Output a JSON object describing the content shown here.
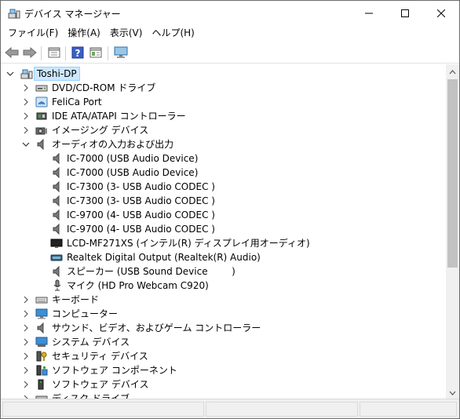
{
  "window": {
    "title": "デバイス マネージャー"
  },
  "menu": [
    {
      "label": "ファイル(F)"
    },
    {
      "label": "操作(A)"
    },
    {
      "label": "表示(V)"
    },
    {
      "label": "ヘルプ(H)"
    }
  ],
  "toolbar": {
    "icons": [
      "back-arrow-icon",
      "forward-arrow-icon",
      "properties-icon",
      "help-icon",
      "view-pane-icon",
      "monitor-icon"
    ]
  },
  "tree": {
    "root": {
      "label": "Toshi-DP",
      "expanded": true
    },
    "categories": [
      {
        "label": "DVD/CD-ROM ドライブ",
        "icon": "dvd-drive-icon",
        "expanded": false
      },
      {
        "label": "FeliCa Port",
        "icon": "felica-icon",
        "expanded": false
      },
      {
        "label": "IDE ATA/ATAPI コントローラー",
        "icon": "ide-controller-icon",
        "expanded": false
      },
      {
        "label": "イメージング デバイス",
        "icon": "camera-icon",
        "expanded": false
      },
      {
        "label": "オーディオの入力および出力",
        "icon": "speaker-icon",
        "expanded": true,
        "children": [
          {
            "label": "IC-7000 (USB Audio Device)",
            "icon": "speaker-icon"
          },
          {
            "label": "IC-7000 (USB Audio Device)",
            "icon": "speaker-icon"
          },
          {
            "label": "IC-7300 (3- USB Audio CODEC )",
            "icon": "speaker-icon"
          },
          {
            "label": "IC-7300 (3- USB Audio CODEC )",
            "icon": "speaker-icon"
          },
          {
            "label": "IC-9700 (4- USB Audio CODEC )",
            "icon": "speaker-icon"
          },
          {
            "label": "IC-9700 (4- USB Audio CODEC )",
            "icon": "speaker-icon"
          },
          {
            "label": "LCD-MF271XS (インテル(R) ディスプレイ用オーディオ)",
            "icon": "monitor-icon"
          },
          {
            "label": "Realtek Digital Output (Realtek(R) Audio)",
            "icon": "digital-output-icon"
          },
          {
            "label": "スピーカー (USB Sound Device        )",
            "icon": "speaker-icon"
          },
          {
            "label": "マイク (HD Pro Webcam C920)",
            "icon": "microphone-icon"
          }
        ]
      },
      {
        "label": "キーボード",
        "icon": "keyboard-icon",
        "expanded": false
      },
      {
        "label": "コンピューター",
        "icon": "computer-icon",
        "expanded": false
      },
      {
        "label": "サウンド、ビデオ、およびゲーム コントローラー",
        "icon": "speaker-icon",
        "expanded": false
      },
      {
        "label": "システム デバイス",
        "icon": "system-device-icon",
        "expanded": false
      },
      {
        "label": "セキュリティ デバイス",
        "icon": "security-key-icon",
        "expanded": false
      },
      {
        "label": "ソフトウェア コンポーネント",
        "icon": "software-component-icon",
        "expanded": false
      },
      {
        "label": "ソフトウェア デバイス",
        "icon": "software-device-icon",
        "expanded": false
      },
      {
        "label": "ディスク ドライブ",
        "icon": "disk-drive-icon",
        "expanded": false
      }
    ]
  },
  "colors": {
    "selection_bg": "#cce8ff",
    "selection_border": "#99d1ff"
  }
}
